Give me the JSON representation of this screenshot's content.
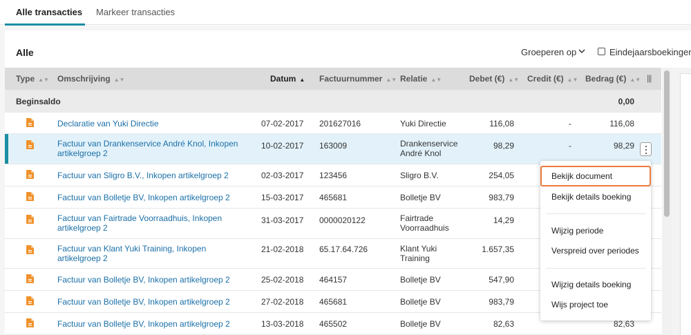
{
  "tabs": [
    {
      "label": "Alle transacties",
      "active": true
    },
    {
      "label": "Markeer transacties",
      "active": false
    }
  ],
  "toolbar": {
    "title": "Alle",
    "group_by": "Groeperen op",
    "year_end_label": "Eindejaarsboekingen",
    "year_end_checked": false
  },
  "table": {
    "headers": {
      "type": "Type",
      "desc": "Omschrijving",
      "date": "Datum",
      "invoice": "Factuurnummer",
      "relation": "Relatie",
      "debet": "Debet (€)",
      "credit": "Credit (€)",
      "amount": "Bedrag (€)"
    },
    "begin": {
      "label": "Beginsaldo",
      "value": "0,00"
    },
    "rows": [
      {
        "desc": "Declaratie van Yuki Directie",
        "date": "07-02-2017",
        "invoice": "201627016",
        "relation": "Yuki Directie",
        "debet": "116,08",
        "credit": "-",
        "amount": "116,08"
      },
      {
        "desc": "Factuur van Drankenservice André Knol, Inkopen artikelgroep 2",
        "date": "10-02-2017",
        "invoice": "163009",
        "relation": "Drankenservice André Knol",
        "debet": "98,29",
        "credit": "-",
        "amount": "98,29"
      },
      {
        "desc": "Factuur van Sligro B.V., Inkopen artikelgroep 2",
        "date": "02-03-2017",
        "invoice": "123456",
        "relation": "Sligro B.V.",
        "debet": "254,05",
        "credit": "",
        "amount": ""
      },
      {
        "desc": "Factuur van Bolletje BV, Inkopen artikelgroep 2",
        "date": "15-03-2017",
        "invoice": "465681",
        "relation": "Bolletje BV",
        "debet": "983,79",
        "credit": "",
        "amount": ""
      },
      {
        "desc": "Factuur van Fairtrade Voorraadhuis, Inkopen artikelgroep 2",
        "date": "31-03-2017",
        "invoice": "0000020122",
        "relation": "Fairtrade Voorraadhuis",
        "debet": "14,29",
        "credit": "",
        "amount": ""
      },
      {
        "desc": "Factuur van Klant Yuki Training, Inkopen artikelgroep 2",
        "date": "21-02-2018",
        "invoice": "65.17.64.726",
        "relation": "Klant Yuki Training",
        "debet": "1.657,35",
        "credit": "",
        "amount": ""
      },
      {
        "desc": "Factuur van Bolletje BV, Inkopen artikelgroep 2",
        "date": "25-02-2018",
        "invoice": "464157",
        "relation": "Bolletje BV",
        "debet": "547,90",
        "credit": "",
        "amount": ""
      },
      {
        "desc": "Factuur van Bolletje BV, Inkopen artikelgroep 2",
        "date": "27-02-2018",
        "invoice": "465681",
        "relation": "Bolletje BV",
        "debet": "983,79",
        "credit": "",
        "amount": ""
      },
      {
        "desc": "Factuur van Bolletje BV, Inkopen artikelgroep 2",
        "date": "13-03-2018",
        "invoice": "465502",
        "relation": "Bolletje BV",
        "debet": "82,63",
        "credit": "",
        "amount": "82,63"
      }
    ]
  },
  "menu": {
    "items": [
      "Bekijk document",
      "Bekijk details boeking",
      "Wijzig periode",
      "Verspreid over periodes",
      "Wijzig details boeking",
      "Wijs project toe"
    ]
  },
  "colors": {
    "accent": "#1b8ea2",
    "link": "#1a6fa8",
    "doc_icon": "#f0922b",
    "highlight": "#ec7a3a",
    "selected_row": "#e3f2fa"
  },
  "icons": {
    "row_type": "document-icon",
    "columns": "columns-icon",
    "row_menu": "kebab-menu-icon"
  }
}
